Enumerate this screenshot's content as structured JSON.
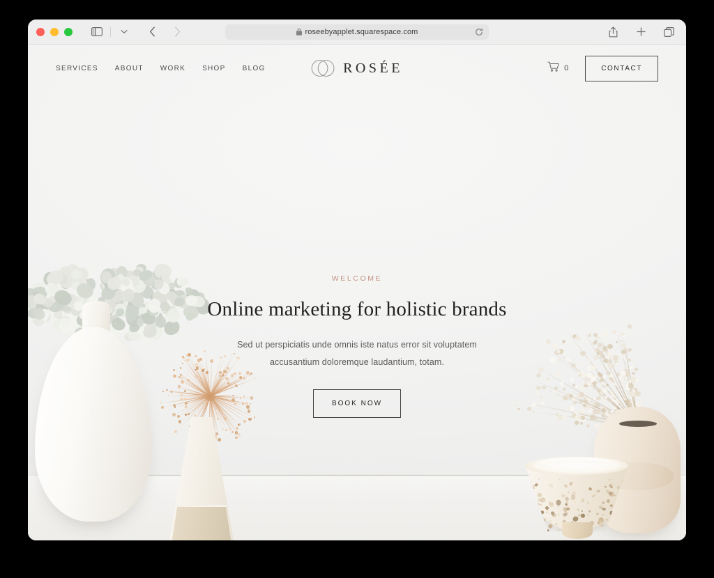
{
  "browser": {
    "traffic_lights": [
      "close",
      "minimize",
      "zoom"
    ],
    "sidebar_toggle": "sidebar-toggle-icon",
    "tab_overview": "chevron-down-icon",
    "back": "back-arrow-icon",
    "forward": "forward-arrow-icon",
    "url": "roseebyapplet.squarespace.com",
    "lock": "lock-icon",
    "reload": "reload-icon",
    "share": "share-icon",
    "new_tab": "plus-icon",
    "tabs": "tabs-icon"
  },
  "site_header": {
    "nav": [
      {
        "label": "SERVICES"
      },
      {
        "label": "ABOUT"
      },
      {
        "label": "WORK"
      },
      {
        "label": "SHOP"
      },
      {
        "label": "BLOG"
      }
    ],
    "brand": {
      "mark": "two-overlapping-circles-logo",
      "name": "ROSÉE"
    },
    "cart": {
      "icon": "shopping-cart-icon",
      "count": "0"
    },
    "contact_label": "CONTACT"
  },
  "hero": {
    "eyebrow": "WELCOME",
    "headline": "Online marketing for holistic brands",
    "subcopy": "Sed ut perspiciatis unde omnis iste natus error sit voluptatem accusantium doloremque laudantium, totam.",
    "cta_label": "BOOK NOW"
  },
  "colors": {
    "page_background": "#f3f3f2",
    "eyebrow_accent": "#c69382",
    "headline": "#23211f",
    "body_text": "#5c5a57",
    "border": "#45423f",
    "desktop_backdrop": "#000000"
  },
  "scene": {
    "description": "still-life photograph of ceramic vases and dried flowers on a white table",
    "objects": [
      "large white teardrop vase with dried sage hydrangea",
      "small conical two-tone vase with tan allium",
      "speckled footed bowl",
      "blush gourd vase with baby's breath"
    ]
  }
}
